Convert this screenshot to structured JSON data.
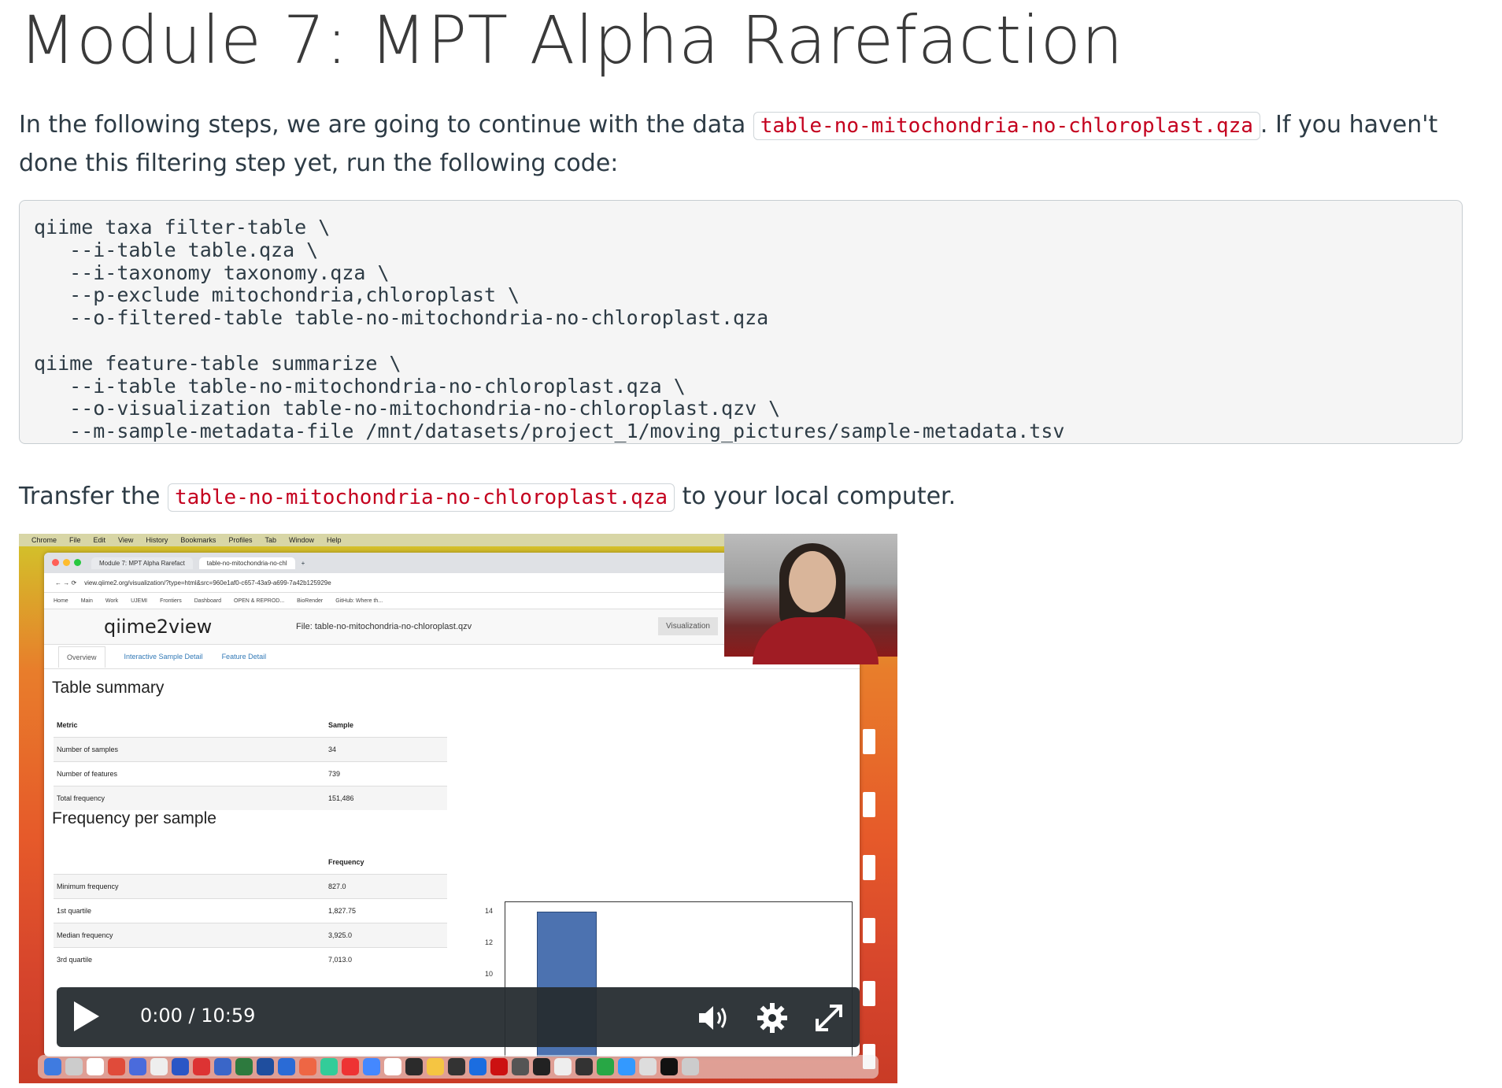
{
  "title": "Module 7: MPT Alpha Rarefaction",
  "intro": {
    "before": "In the following steps, we are going to continue with the data ",
    "code": "table-no-mitochondria-no-chloroplast.qza",
    "after": ". If you haven't done this filtering step yet, run the following code:"
  },
  "code_block": "qiime taxa filter-table \\\n   --i-table table.qza \\\n   --i-taxonomy taxonomy.qza \\\n   --p-exclude mitochondria,chloroplast \\\n   --o-filtered-table table-no-mitochondria-no-chloroplast.qza\n\nqiime feature-table summarize \\\n   --i-table table-no-mitochondria-no-chloroplast.qza \\\n   --o-visualization table-no-mitochondria-no-chloroplast.qzv \\\n   --m-sample-metadata-file /mnt/datasets/project_1/moving_pictures/sample-metadata.tsv",
  "transfer": {
    "before": "Transfer the ",
    "code": "table-no-mitochondria-no-chloroplast.qza",
    "after": " to your local computer."
  },
  "video": {
    "time": "0:00 / 10:59",
    "menubar": [
      "Chrome",
      "File",
      "Edit",
      "View",
      "History",
      "Bookmarks",
      "Profiles",
      "Tab",
      "Window",
      "Help"
    ],
    "tabs": [
      "Module 7: MPT Alpha Rarefact",
      "table-no-mitochondria-no-chl"
    ],
    "url": "view.qiime2.org/visualization/?type=html&src=960e1af0-c657-43a9-a699-7a42b125929e",
    "bookmarks": [
      "Home",
      "Main",
      "Work",
      "UJEMI",
      "Frontiers",
      "Dashboard",
      "OPEN & REPROD...",
      "BioRender",
      "GitHub: Where th..."
    ],
    "q2_logo": "qiime2view",
    "q2_file": "File: table-no-mitochondria-no-chloroplast.qzv",
    "q2_visualization": "Visualization",
    "q2_tabs": [
      "Overview",
      "Interactive Sample Detail",
      "Feature Detail"
    ],
    "table_summary": {
      "heading": "Table summary",
      "header": [
        "Metric",
        "Sample"
      ],
      "rows": [
        [
          "Number of samples",
          "34"
        ],
        [
          "Number of features",
          "739"
        ],
        [
          "Total frequency",
          "151,486"
        ]
      ]
    },
    "freq_per_sample": {
      "heading": "Frequency per sample",
      "header": [
        "",
        "Frequency"
      ],
      "rows": [
        [
          "Minimum frequency",
          "827.0"
        ],
        [
          "1st quartile",
          "1,827.75"
        ],
        [
          "Median frequency",
          "3,925.0"
        ],
        [
          "3rd quartile",
          "7,013.0"
        ]
      ]
    },
    "yticks": [
      "14",
      "12",
      "10"
    ]
  }
}
